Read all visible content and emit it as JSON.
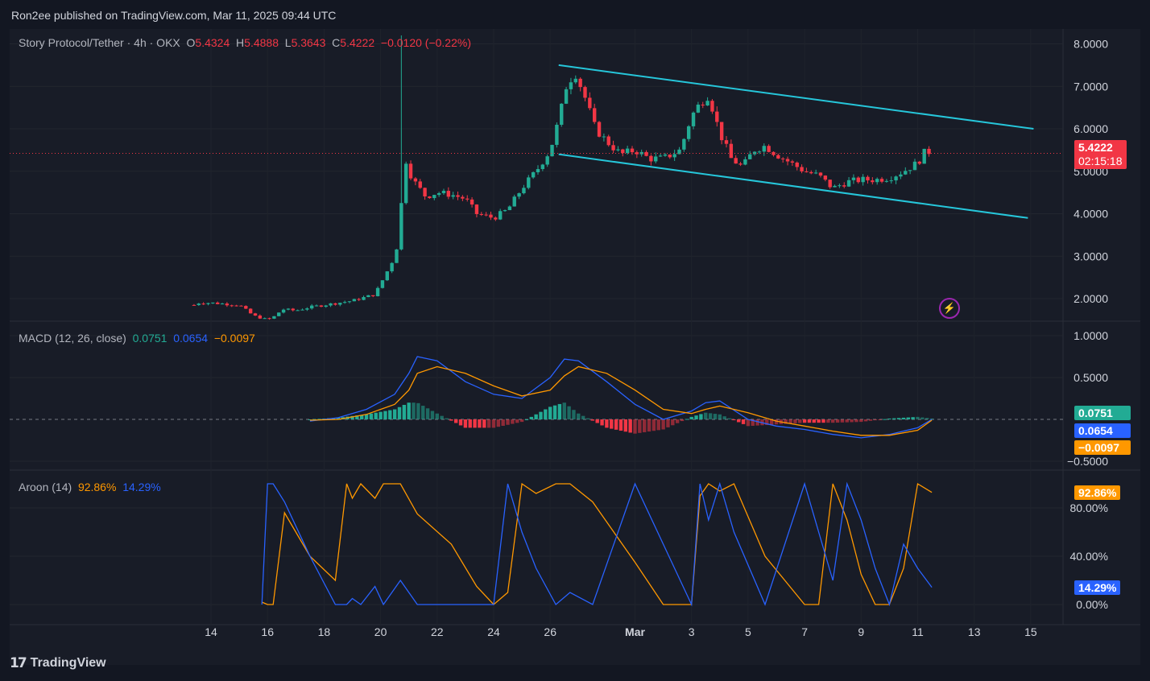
{
  "header": {
    "published": "Ron2ee published on TradingView.com, Mar 11, 2025 09:44 UTC"
  },
  "legend": {
    "symbol": "Story Protocol/Tether · 4h · OKX",
    "o_label": "O",
    "o": "5.4324",
    "h_label": "H",
    "h": "5.4888",
    "l_label": "L",
    "l": "5.3643",
    "c_label": "C",
    "c": "5.4222",
    "change": "−0.0120 (−0.22%)"
  },
  "macd_legend": {
    "title": "MACD (12, 26, close)",
    "macd": "0.0751",
    "signal": "0.0654",
    "hist": "−0.0097"
  },
  "aroon_legend": {
    "title": "Aroon (14)",
    "up": "92.86%",
    "down": "14.29%"
  },
  "price_tag": {
    "price": "5.4222",
    "countdown": "02:15:18"
  },
  "macd_tags": {
    "hist": "0.0751",
    "macd": "0.0654",
    "signal": "−0.0097"
  },
  "aroon_tags": {
    "up": "92.86%",
    "down": "14.29%"
  },
  "footer": {
    "brand": "TradingView"
  },
  "colors": {
    "up": "#22ab94",
    "down": "#f23645",
    "channel": "#26c6da",
    "macd": "#2962ff",
    "signal": "#ff9800",
    "aroon_up": "#ff9800",
    "aroon_down": "#2962ff",
    "hist_pos": "#22ab94",
    "hist_neg": "#f23645"
  },
  "chart_data": [
    {
      "type": "candlestick",
      "title": "Story Protocol/Tether · 4h · OKX",
      "y_ticks": [
        "8.0000",
        "7.0000",
        "6.0000",
        "5.0000",
        "4.0000",
        "3.0000",
        "2.0000"
      ],
      "ylim": [
        1.45,
        8.2
      ],
      "x_ticks": [
        "14",
        "16",
        "18",
        "20",
        "22",
        "24",
        "26",
        "Mar",
        "3",
        "5",
        "7",
        "9",
        "11",
        "13",
        "15"
      ],
      "x_tick_days": [
        14,
        16,
        18,
        20,
        22,
        24,
        26,
        29,
        31,
        33,
        35,
        37,
        39,
        41,
        43
      ],
      "x_unit": "day index (Feb 1 = 1, Mar 1 = 29)",
      "close_path_days": [
        13.4,
        13.5,
        14,
        15,
        15.5,
        16,
        16.3,
        16.5,
        17,
        17.5,
        18,
        19,
        19.8,
        20.2,
        20.5,
        20.7,
        20.8,
        21,
        21.2,
        21.6,
        22,
        22.5,
        23,
        23.4,
        23.7,
        24,
        24.5,
        25,
        25.5,
        25.8,
        26,
        26.3,
        26.6,
        26.9,
        27.2,
        27.6,
        28,
        28.5,
        29,
        29.5,
        30,
        30.6,
        31,
        31.3,
        31.6,
        32,
        32.4,
        32.8,
        33.2,
        33.6,
        34,
        34.5,
        35,
        35.5,
        36,
        36.5,
        37,
        37.5,
        38,
        38.5,
        39,
        39.3,
        39.5
      ],
      "close_path_values": [
        1.85,
        1.9,
        1.9,
        1.85,
        1.6,
        1.5,
        1.6,
        1.75,
        1.72,
        1.8,
        1.85,
        1.95,
        2.1,
        2.6,
        3.0,
        3.6,
        5.5,
        5.0,
        4.75,
        4.4,
        4.5,
        4.45,
        4.35,
        4.0,
        3.95,
        3.9,
        4.1,
        4.6,
        5.0,
        5.3,
        5.5,
        6.2,
        7.1,
        7.3,
        6.8,
        6.0,
        5.7,
        5.4,
        5.5,
        5.3,
        5.3,
        5.5,
        6.3,
        6.6,
        6.8,
        5.9,
        5.3,
        5.1,
        5.5,
        5.6,
        5.4,
        5.2,
        5.0,
        4.9,
        4.6,
        4.75,
        4.8,
        4.8,
        4.85,
        5.0,
        5.2,
        5.5,
        5.42
      ],
      "high_spike": {
        "day": 20.8,
        "value": 8.2
      },
      "channel_upper": [
        [
          26.3,
          7.5
        ],
        [
          43.1,
          6.0
        ]
      ],
      "channel_lower": [
        [
          26.3,
          5.4
        ],
        [
          42.9,
          3.9
        ]
      ],
      "last_price": 5.4222
    },
    {
      "type": "line",
      "title": "MACD (12, 26, close)",
      "y_ticks": [
        "1.0000",
        "0.5000",
        "−0.5000"
      ],
      "ylim": [
        -0.5,
        1.0
      ],
      "x_days": [
        17.5,
        18.5,
        19.5,
        20.5,
        21,
        21.3,
        22,
        23,
        24,
        25,
        26,
        26.5,
        27,
        28,
        29,
        30,
        31,
        31.5,
        32,
        33,
        34,
        35,
        36,
        37,
        38,
        39,
        39.5
      ],
      "series": [
        {
          "role": "macd",
          "values": [
            -0.02,
            0.02,
            0.12,
            0.3,
            0.55,
            0.75,
            0.7,
            0.45,
            0.3,
            0.25,
            0.5,
            0.72,
            0.7,
            0.45,
            0.18,
            0.0,
            0.1,
            0.2,
            0.22,
            0.0,
            -0.08,
            -0.12,
            -0.18,
            -0.22,
            -0.18,
            -0.1,
            0.0
          ]
        },
        {
          "role": "signal",
          "values": [
            -0.01,
            0.0,
            0.06,
            0.18,
            0.35,
            0.55,
            0.63,
            0.55,
            0.4,
            0.28,
            0.35,
            0.52,
            0.63,
            0.55,
            0.35,
            0.12,
            0.07,
            0.12,
            0.16,
            0.08,
            -0.02,
            -0.08,
            -0.14,
            -0.19,
            -0.19,
            -0.13,
            -0.01
          ]
        },
        {
          "role": "histogram",
          "values": [
            0.0,
            0.02,
            0.06,
            0.12,
            0.2,
            0.2,
            0.07,
            -0.1,
            -0.1,
            -0.03,
            0.15,
            0.2,
            0.07,
            -0.1,
            -0.17,
            -0.12,
            0.03,
            0.08,
            0.06,
            -0.08,
            -0.06,
            -0.04,
            -0.04,
            -0.03,
            0.01,
            0.03,
            0.01
          ]
        }
      ],
      "last_values": {
        "macd": 0.0751,
        "signal": 0.0654,
        "histogram": -0.0097
      }
    },
    {
      "type": "line",
      "title": "Aroon (14)",
      "y_ticks": [
        "80.00%",
        "40.00%",
        "0.00%"
      ],
      "ylim": [
        0,
        100
      ],
      "x_days": [
        15.8,
        16.0,
        16.2,
        16.6,
        17.5,
        18.4,
        18.8,
        19.0,
        19.3,
        19.8,
        20.1,
        20.7,
        21.3,
        22.5,
        23.4,
        24.0,
        24.5,
        25.0,
        25.5,
        26.2,
        26.7,
        27.5,
        29.0,
        30.0,
        31.0,
        31.3,
        31.6,
        32.0,
        32.5,
        33.6,
        35.0,
        35.5,
        36.0,
        36.5,
        37.0,
        37.5,
        38.0,
        38.5,
        39.0,
        39.5
      ],
      "series": [
        {
          "role": "up",
          "values": [
            2,
            0,
            0,
            76,
            40,
            20,
            100,
            88,
            100,
            88,
            100,
            100,
            75,
            50,
            15,
            0,
            10,
            100,
            92,
            100,
            100,
            85,
            35,
            0,
            0,
            90,
            100,
            94,
            100,
            40,
            0,
            0,
            100,
            70,
            25,
            0,
            0,
            30,
            100,
            92.86
          ]
        },
        {
          "role": "down",
          "values": [
            0,
            100,
            100,
            85,
            40,
            0,
            0,
            5,
            0,
            15,
            0,
            20,
            0,
            0,
            0,
            0,
            100,
            60,
            30,
            0,
            10,
            0,
            100,
            50,
            0,
            100,
            70,
            100,
            60,
            0,
            100,
            60,
            20,
            100,
            70,
            30,
            0,
            50,
            30,
            14.29
          ]
        }
      ],
      "last_values": {
        "up": 92.86,
        "down": 14.29
      }
    }
  ]
}
